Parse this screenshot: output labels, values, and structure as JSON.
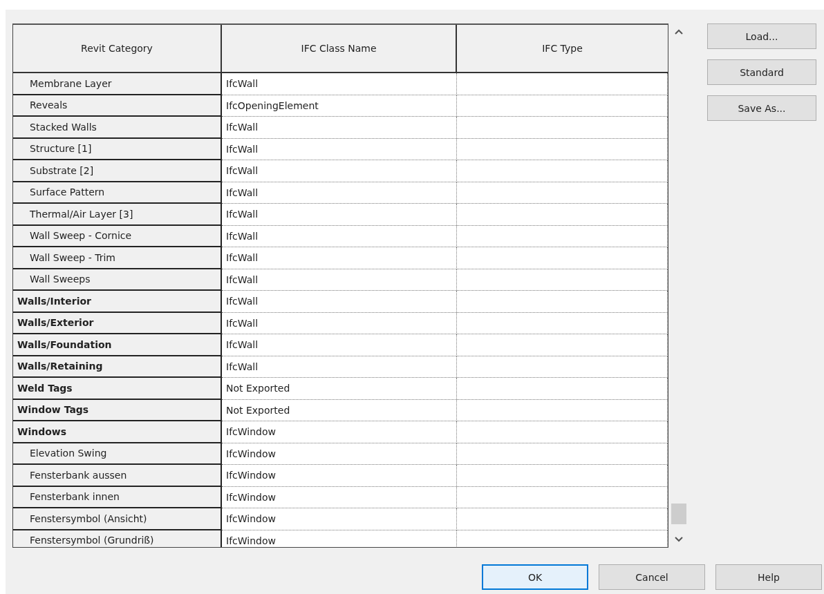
{
  "table": {
    "columns": [
      "Revit Category",
      "IFC Class Name",
      "IFC Type"
    ],
    "rows": [
      {
        "children": [
          {
            "category": "Membrane Layer",
            "ifc_class": "IfcWall"
          },
          {
            "category": "Reveals",
            "ifc_class": "IfcOpeningElement"
          },
          {
            "category": "Stacked Walls",
            "ifc_class": "IfcWall"
          },
          {
            "category": "Structure [1]",
            "ifc_class": "IfcWall"
          },
          {
            "category": "Substrate [2]",
            "ifc_class": "IfcWall"
          },
          {
            "category": "Surface Pattern",
            "ifc_class": "IfcWall"
          },
          {
            "category": "Thermal/Air Layer [3]",
            "ifc_class": "IfcWall"
          },
          {
            "category": "Wall Sweep - Cornice",
            "ifc_class": "IfcWall"
          },
          {
            "category": "Wall Sweep - Trim",
            "ifc_class": "IfcWall"
          },
          {
            "category": "Wall Sweeps",
            "ifc_class": "IfcWall"
          }
        ]
      },
      {
        "category": "Walls/Interior",
        "ifc_class": "IfcWall"
      },
      {
        "category": "Walls/Exterior",
        "ifc_class": "IfcWall"
      },
      {
        "category": "Walls/Foundation",
        "ifc_class": "IfcWall"
      },
      {
        "category": "Walls/Retaining",
        "ifc_class": "IfcWall"
      },
      {
        "category": "Weld Tags",
        "ifc_class": "Not Exported"
      },
      {
        "category": "Window Tags",
        "ifc_class": "Not Exported"
      },
      {
        "category": "Windows",
        "ifc_class": "IfcWindow",
        "children": [
          {
            "category": "Elevation Swing",
            "ifc_class": "IfcWindow"
          },
          {
            "category": "Fensterbank aussen",
            "ifc_class": "IfcWindow"
          },
          {
            "category": "Fensterbank innen",
            "ifc_class": "IfcWindow"
          },
          {
            "category": "Fenstersymbol (Ansicht)",
            "ifc_class": "IfcWindow"
          },
          {
            "category": "Fenstersymbol (Grundriß)",
            "ifc_class": "IfcWindow"
          }
        ]
      }
    ]
  },
  "side_buttons": [
    "Load...",
    "Standard",
    "Save As..."
  ],
  "footer_buttons": [
    {
      "label": "OK",
      "default": true
    },
    {
      "label": "Cancel",
      "default": false
    },
    {
      "label": "Help",
      "default": false
    }
  ]
}
